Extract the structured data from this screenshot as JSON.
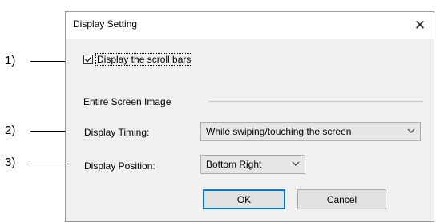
{
  "callouts": [
    "1)",
    "2)",
    "3)"
  ],
  "dialog": {
    "title": "Display Setting",
    "close_glyph": "✕",
    "scrollbar_checkbox": {
      "label": "Display the scroll bars",
      "checked": true
    },
    "group_label": "Entire Screen Image",
    "timing": {
      "label": "Display Timing:",
      "value": "While swiping/touching the screen"
    },
    "position": {
      "label": "Display Position:",
      "value": "Bottom Right"
    },
    "ok_label": "OK",
    "cancel_label": "Cancel"
  }
}
